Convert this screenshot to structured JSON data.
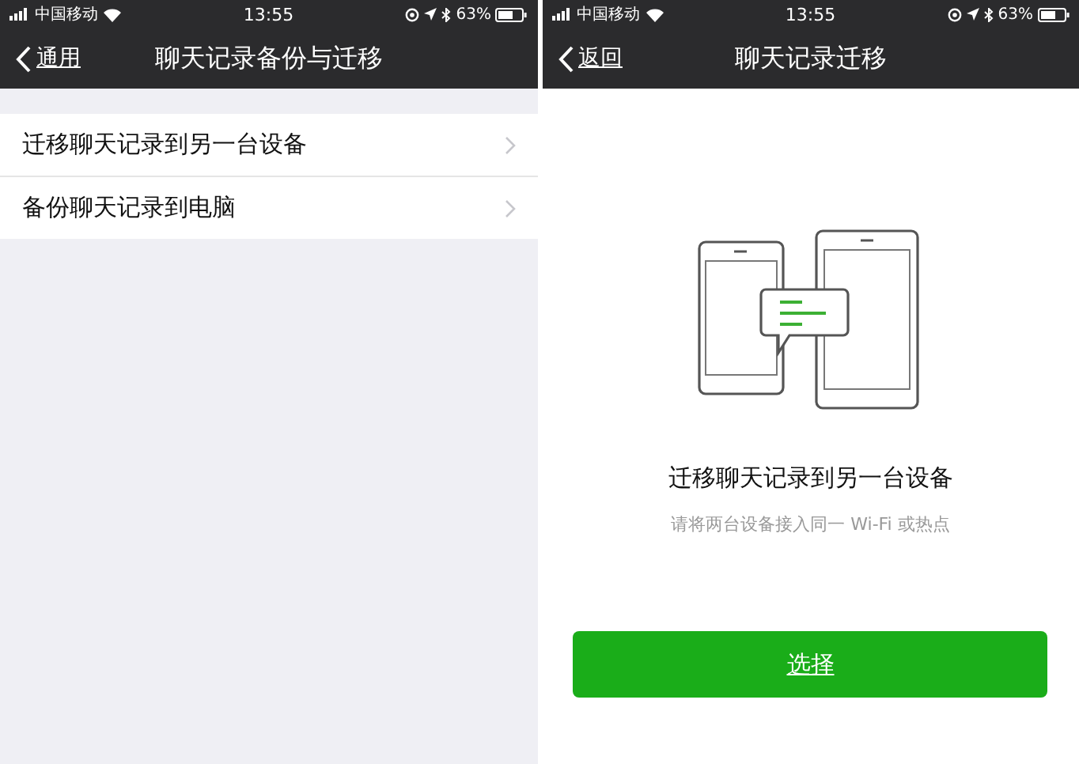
{
  "screens": [
    {
      "status_bar": {
        "carrier": "中国移动",
        "time": "13:55",
        "battery": "63%"
      },
      "nav": {
        "back": "通用",
        "title": "聊天记录备份与迁移"
      },
      "items": [
        {
          "label": "迁移聊天记录到另一台设备"
        },
        {
          "label": "备份聊天记录到电脑"
        }
      ]
    },
    {
      "status_bar": {
        "carrier": "中国移动",
        "time": "13:55",
        "battery": "63%"
      },
      "nav": {
        "back": "返回",
        "title": "聊天记录迁移"
      },
      "heading": "迁移聊天记录到另一台设备",
      "hint": "请将两台设备接入同一 Wi-Fi 或热点",
      "button": "选择"
    }
  ]
}
